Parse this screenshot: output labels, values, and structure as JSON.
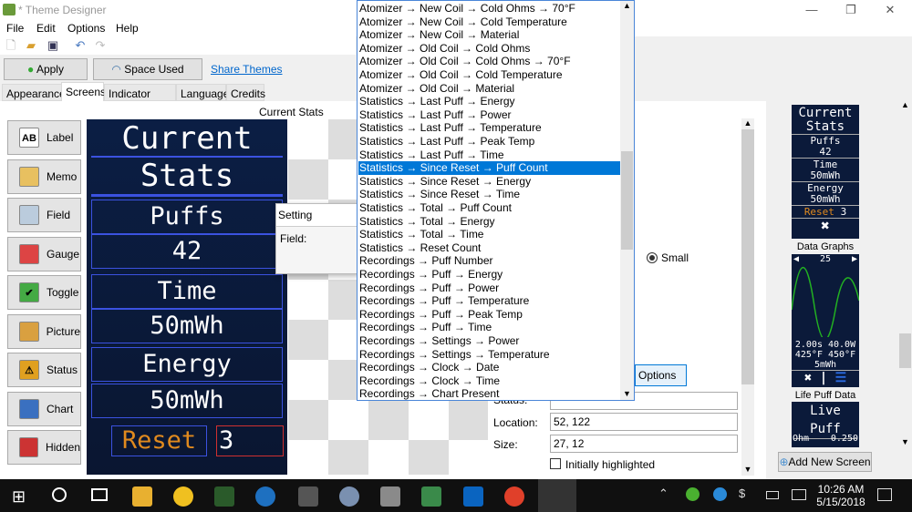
{
  "window": {
    "title": "* Theme Designer"
  },
  "menu": [
    "File",
    "Edit",
    "Options",
    "Help"
  ],
  "toolbar_icons": [
    "new-file-icon",
    "open-folder-icon",
    "save-icon",
    "undo-icon",
    "redo-icon"
  ],
  "buttons": {
    "apply": "Apply",
    "space_used": "Space Used",
    "share_themes": "Share Themes"
  },
  "tabs": [
    "Appearance",
    "Screens",
    "Indicator Light",
    "Language",
    "Credits"
  ],
  "active_tab": "Screens",
  "tools": [
    {
      "label": "Label",
      "icon": "AB"
    },
    {
      "label": "Memo",
      "icon": ""
    },
    {
      "label": "Field",
      "icon": ""
    },
    {
      "label": "Gauge",
      "icon": ""
    },
    {
      "label": "Toggle",
      "icon": "✔"
    },
    {
      "label": "Picture",
      "icon": ""
    },
    {
      "label": "Status",
      "icon": "⚠"
    },
    {
      "label": "Chart",
      "icon": ""
    },
    {
      "label": "Hidden",
      "icon": ""
    }
  ],
  "screen_name": "Current Stats",
  "preview": {
    "title1": "Current",
    "title2": "Stats",
    "rows": [
      "Puffs",
      "42",
      "Time",
      "50mWh",
      "Energy",
      "50mWh"
    ],
    "reset_label": "Reset",
    "reset_value": "3"
  },
  "setting_popup": {
    "title": "Setting",
    "field_label": "Field:"
  },
  "dropdown": {
    "items": [
      "Atomizer → New Coil → Cold Ohms → 70°F",
      "Atomizer → New Coil → Cold Temperature",
      "Atomizer → New Coil → Material",
      "Atomizer → Old Coil → Cold Ohms",
      "Atomizer → Old Coil → Cold Ohms → 70°F",
      "Atomizer → Old Coil → Cold Temperature",
      "Atomizer → Old Coil → Material",
      "Statistics → Last Puff → Energy",
      "Statistics → Last Puff → Power",
      "Statistics → Last Puff → Temperature",
      "Statistics → Last Puff → Peak Temp",
      "Statistics → Last Puff → Time",
      "Statistics → Since Reset → Puff Count",
      "Statistics → Since Reset → Energy",
      "Statistics → Since Reset → Time",
      "Statistics → Total → Puff Count",
      "Statistics → Total → Energy",
      "Statistics → Total → Time",
      "Statistics → Reset Count",
      "Recordings → Puff Number",
      "Recordings → Puff → Energy",
      "Recordings → Puff → Power",
      "Recordings → Puff → Temperature",
      "Recordings → Puff → Peak Temp",
      "Recordings → Puff → Time",
      "Recordings → Settings → Power",
      "Recordings → Settings → Temperature",
      "Recordings → Clock → Date",
      "Recordings → Clock → Time",
      "Recordings → Chart Present"
    ],
    "selected": "Statistics → Since Reset → Puff Count"
  },
  "properties": {
    "radio_small": "Small",
    "options_button": "Options",
    "status_label": "Status:",
    "location_label": "Location:",
    "location_value": "52, 122",
    "size_label": "Size:",
    "size_value": "27, 12",
    "initially_highlighted": "Initially highlighted",
    "initially_highlighted_checked": false
  },
  "screens_panel": {
    "current_stats": {
      "label": "Current Stats",
      "lines": [
        "Current",
        "Stats",
        "Puffs",
        "42",
        "Time",
        "50mWh",
        "Energy",
        "50mWh"
      ],
      "reset": "Reset",
      "reset_value": "3"
    },
    "data_graphs": {
      "label": "Data Graphs",
      "value": "25",
      "line1": "2.00s 40.0W",
      "line2": "425°F 450°F",
      "line3": "5mWh"
    },
    "life_puff": {
      "label": "Life Puff Data",
      "title": "Live Puff",
      "left": "Ohm",
      "right": "0.250"
    },
    "add_button": "Add New Screen"
  },
  "taskbar": {
    "time": "10:26 AM",
    "date": "5/15/2018"
  },
  "colors": {
    "accent": "#0078d7",
    "preview_bg": "#0b1e44",
    "reset": "#e08a1e",
    "graph_line": "#22b022"
  }
}
